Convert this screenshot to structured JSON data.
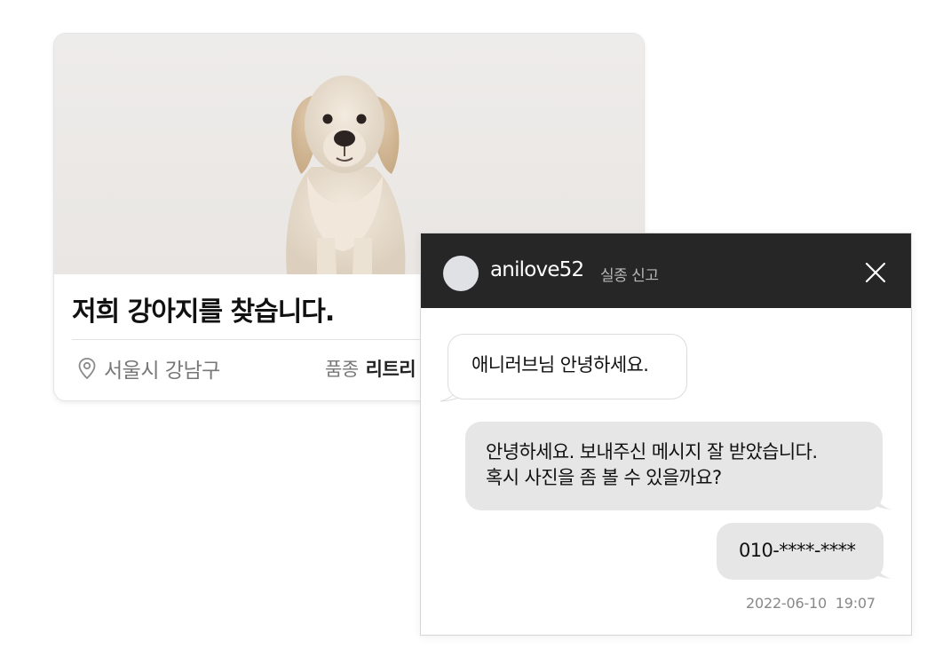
{
  "post": {
    "title": "저희 강아지를 찾습니다.",
    "location": "서울시 강남구",
    "breed_label": "품종",
    "breed_value": "리트리",
    "photo_icon": "golden-retriever-puppy-photo"
  },
  "chat": {
    "username": "anilove52",
    "subtitle": "실종 신고",
    "close_icon": "close-icon",
    "messages": [
      {
        "direction": "incoming",
        "text": "애니러브님 안녕하세요."
      },
      {
        "direction": "outgoing",
        "lines": [
          "안녕하세요. 보내주신 메시지 잘 받았습니다.",
          "혹시 사진을 좀 볼 수 있을까요?"
        ]
      },
      {
        "direction": "outgoing",
        "text": "010-****-****"
      }
    ],
    "timestamp": "2022-06-10  19:07"
  },
  "colors": {
    "header_bg": "#262626",
    "outgoing_bubble": "#e6e6e6",
    "incoming_bubble": "#ffffff"
  }
}
